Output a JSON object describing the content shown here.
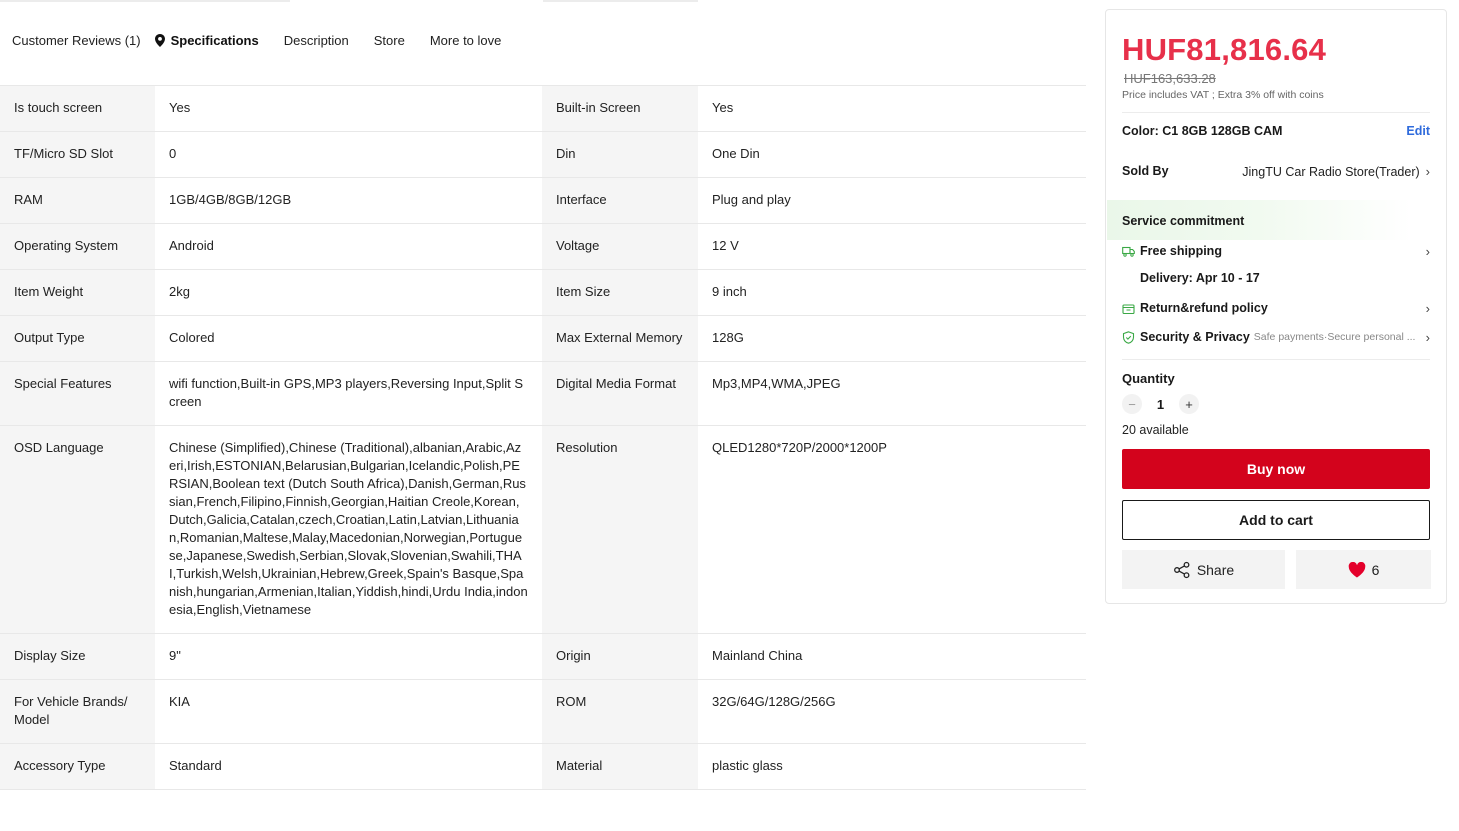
{
  "tabs": [
    {
      "label": "Customer Reviews (1)",
      "active": false
    },
    {
      "label": "Specifications",
      "active": true
    },
    {
      "label": "Description",
      "active": false
    },
    {
      "label": "Store",
      "active": false
    },
    {
      "label": "More to love",
      "active": false
    }
  ],
  "specs": [
    [
      {
        "k": "Is touch screen",
        "v": "Yes"
      },
      {
        "k": "Built-in Screen",
        "v": "Yes"
      }
    ],
    [
      {
        "k": "TF/Micro SD Slot",
        "v": "0"
      },
      {
        "k": "Din",
        "v": "One Din"
      }
    ],
    [
      {
        "k": "RAM",
        "v": "1GB/4GB/8GB/12GB"
      },
      {
        "k": "Interface",
        "v": "Plug and play"
      }
    ],
    [
      {
        "k": "Operating System",
        "v": "Android"
      },
      {
        "k": "Voltage",
        "v": "12 V"
      }
    ],
    [
      {
        "k": "Item Weight",
        "v": "2kg"
      },
      {
        "k": "Item Size",
        "v": "9 inch"
      }
    ],
    [
      {
        "k": "Output Type",
        "v": "Colored"
      },
      {
        "k": "Max External Memory",
        "v": "128G"
      }
    ],
    [
      {
        "k": "Special Features",
        "v": "wifi function,Built-in GPS,MP3 players,Reversing Input,Split Screen"
      },
      {
        "k": "Digital Media Format",
        "v": "Mp3,MP4,WMA,JPEG"
      }
    ],
    [
      {
        "k": "OSD Language",
        "v": "Chinese (Simplified),Chinese (Traditional),albanian,Arabic,Azeri,Irish,ESTONIAN,Belarusian,Bulgarian,Icelandic,Polish,PERSIAN,Boolean text (Dutch South Africa),Danish,German,Russian,French,Filipino,Finnish,Georgian,Haitian Creole,Korean,Dutch,Galicia,Catalan,czech,Croatian,Latin,Latvian,Lithuanian,Romanian,Maltese,Malay,Macedonian,Norwegian,Portuguese,Japanese,Swedish,Serbian,Slovak,Slovenian,Swahili,THAI,Turkish,Welsh,Ukrainian,Hebrew,Greek,Spain's Basque,Spanish,hungarian,Armenian,Italian,Yiddish,hindi,Urdu India,indonesia,English,Vietnamese"
      },
      {
        "k": "Resolution",
        "v": "QLED1280*720P/2000*1200P"
      }
    ],
    [
      {
        "k": "Display Size",
        "v": "9\""
      },
      {
        "k": "Origin",
        "v": "Mainland China"
      }
    ],
    [
      {
        "k": "For Vehicle Brands/ Model",
        "v": "KIA"
      },
      {
        "k": "ROM",
        "v": "32G/64G/128G/256G"
      }
    ],
    [
      {
        "k": "Accessory Type",
        "v": "Standard"
      },
      {
        "k": "Material",
        "v": "plastic glass"
      }
    ]
  ],
  "buybox": {
    "price": "HUF81,816.64",
    "original_price": "HUF163,633.28",
    "vat_note": "Price includes VAT ; Extra 3% off with coins",
    "color_label": "Color: C1 8GB 128GB CAM",
    "edit_label": "Edit",
    "sold_by_label": "Sold By",
    "store_name": "JingTU Car Radio Store(Trader)",
    "service_title": "Service commitment",
    "free_shipping": "Free shipping",
    "delivery": "Delivery: Apr 10 - 17",
    "return_policy": "Return&refund policy",
    "security_title": "Security & Privacy",
    "security_sub": "Safe payments·Secure personal ...",
    "quantity_label": "Quantity",
    "quantity_value": "1",
    "minus": "−",
    "plus": "+",
    "available": "20 available",
    "buy_now": "Buy now",
    "add_to_cart": "Add to cart",
    "share": "Share",
    "wish_count": "6"
  },
  "colors": {
    "price_red": "#e7304a",
    "buy_red": "#d3031c",
    "link_blue": "#2f6bdc",
    "service_green": "#3aa845"
  }
}
